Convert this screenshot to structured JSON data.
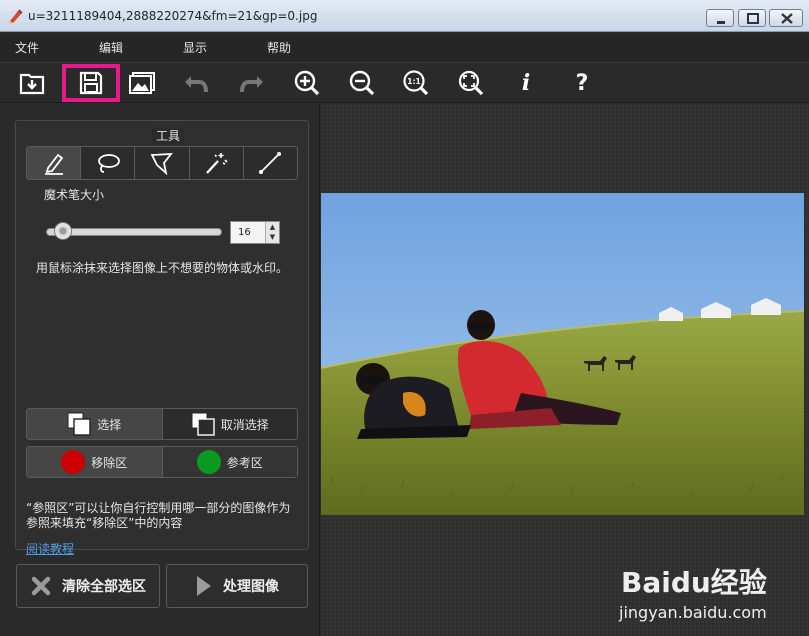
{
  "window": {
    "title": "u=3211189404,2888220274&fm=21&gp=0.jpg"
  },
  "menu": [
    "文件",
    "编辑",
    "显示",
    "帮助"
  ],
  "toolbar": {
    "buttons": [
      "open-icon",
      "save-icon",
      "image-icon",
      "undo-icon",
      "redo-icon",
      "zoom-in-icon",
      "zoom-out-icon",
      "actual-size-icon",
      "fit-icon",
      "info-icon",
      "help-icon"
    ],
    "actual_size_label": "1:1",
    "info_label": "i",
    "help_label": "?",
    "highlight_color": "#e8198b"
  },
  "tools": {
    "title": "工具",
    "items": [
      "pencil-icon",
      "lasso-icon",
      "polygon-lasso-icon",
      "magic-wand-icon",
      "line-icon"
    ],
    "active_index": 0
  },
  "brush": {
    "label": "魔术笔大小",
    "value": "16",
    "slider_fraction": 0.05
  },
  "hint": "用鼠标涂抹来选择图像上不想要的物体或水印。",
  "selection": {
    "select_label": "选择",
    "deselect_label": "取消选择"
  },
  "regions": {
    "remove_label": "移除区",
    "remove_color": "#cc0000",
    "reference_label": "参考区",
    "reference_color": "#0a9a1f"
  },
  "note": "“参照区”可以让你自行控制用哪一部分的图像作为参照来填充“移除区”中的内容",
  "tutorial_link": "阅读教程",
  "actions": {
    "clear_label": "清除全部选区",
    "process_label": "处理图像"
  },
  "watermark": {
    "brand": "Baidu经验",
    "url": "jingyan.baidu.com"
  }
}
